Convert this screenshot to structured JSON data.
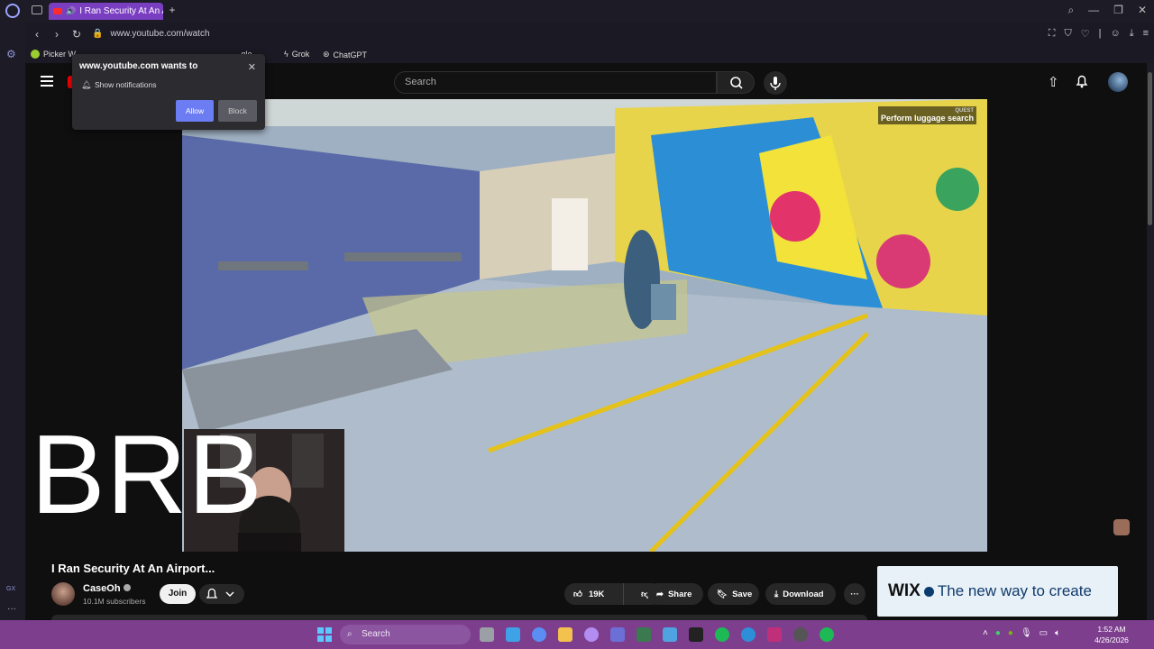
{
  "browser": {
    "tab_title": "I Ran Security At An Airport...",
    "url": "www.youtube.com/watch",
    "bookmarks": [
      {
        "label": "Picker W..."
      },
      {
        "label": "...gle"
      },
      {
        "label": "Grok"
      },
      {
        "label": "ChatGPT"
      }
    ],
    "sidebar_labels": {
      "gx": "GX",
      "more": "···"
    }
  },
  "notification_prompt": {
    "title": "www.youtube.com wants to",
    "body": "Show notifications",
    "allow_label": "Allow",
    "block_label": "Block"
  },
  "youtube": {
    "search_placeholder": "Search",
    "video": {
      "quest_label": "QUEST",
      "quest_text": "Perform luggage search",
      "overlay_text": "BRB",
      "title": "I Ran Security At An Airport...",
      "channel_name": "CaseOh",
      "subscribers": "10.1M subscribers",
      "join_label": "Join",
      "likes": "19K",
      "share_label": "Share",
      "save_label": "Save",
      "download_label": "Download"
    },
    "ad": {
      "brand": "WIX",
      "slogan": "The new way to create"
    }
  },
  "taskbar": {
    "search_placeholder": "Search",
    "time": "1:52 AM",
    "date": "4/26/2026"
  },
  "colors": {
    "browser_accent": "#7a3fc0",
    "allow_button": "#6c7cf2",
    "taskbar": "#7d3e8e",
    "youtube_red": "#ff0000"
  }
}
